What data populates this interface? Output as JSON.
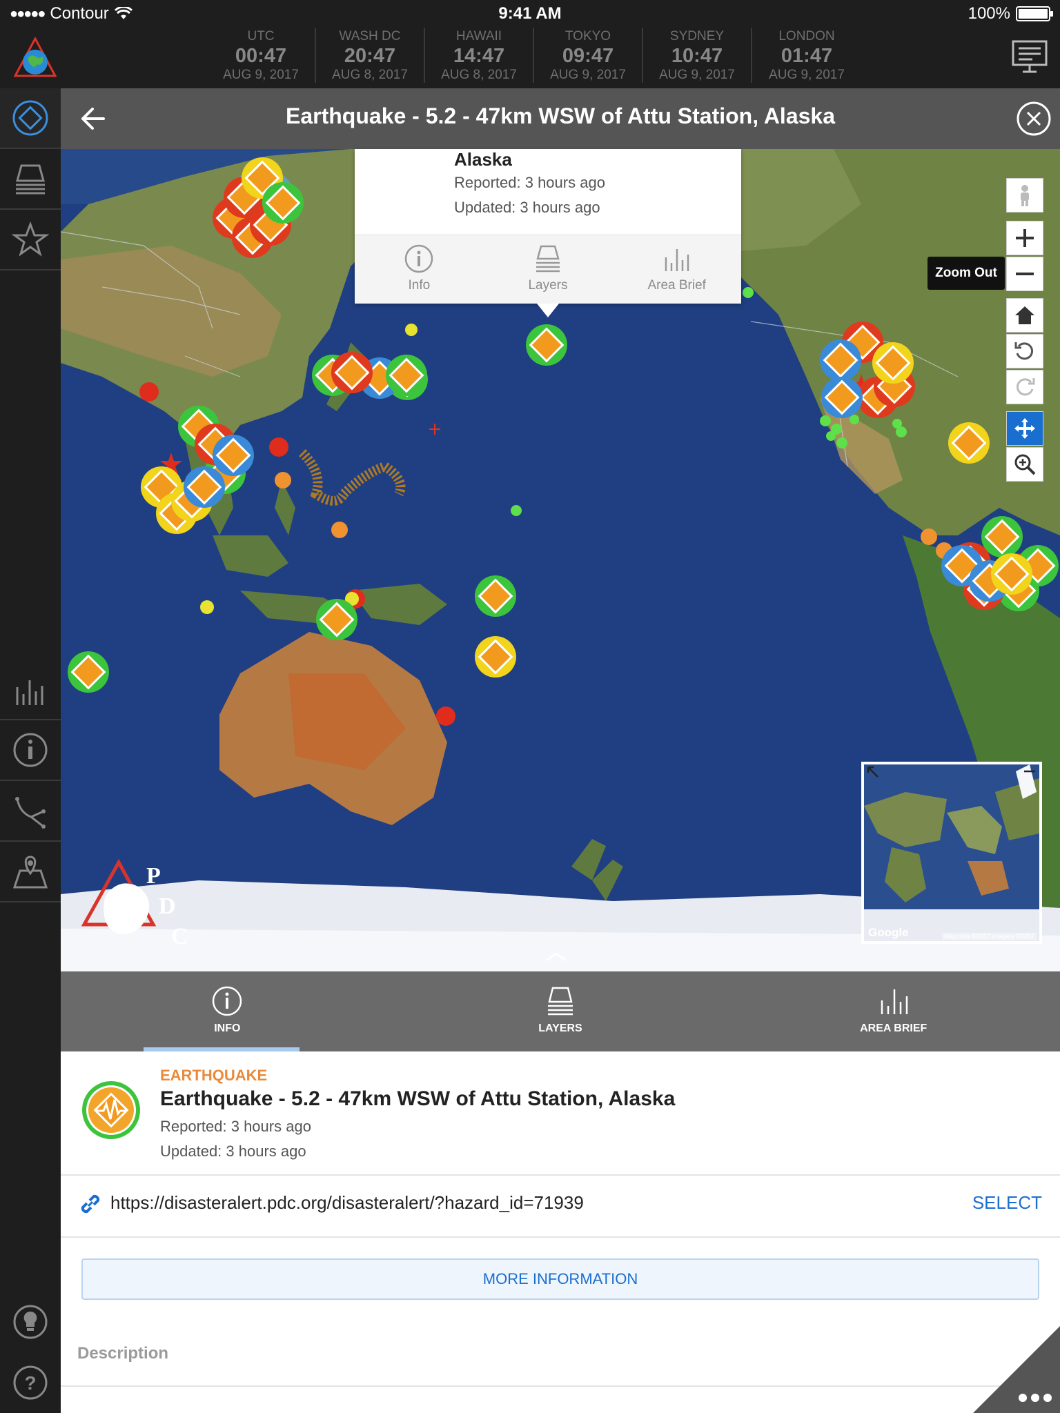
{
  "status_bar": {
    "carrier": "Contour",
    "time": "9:41 AM",
    "battery": "100%",
    "battery_level": 1.0
  },
  "clocks": [
    {
      "city": "UTC",
      "time": "00:47",
      "date": "AUG 9, 2017"
    },
    {
      "city": "WASH DC",
      "time": "20:47",
      "date": "AUG 8, 2017"
    },
    {
      "city": "HAWAII",
      "time": "14:47",
      "date": "AUG 8, 2017"
    },
    {
      "city": "TOKYO",
      "time": "09:47",
      "date": "AUG 9, 2017"
    },
    {
      "city": "SYDNEY",
      "time": "10:47",
      "date": "AUG 9, 2017"
    },
    {
      "city": "LONDON",
      "time": "01:47",
      "date": "AUG 9, 2017"
    }
  ],
  "title_bar": {
    "title": "Earthquake - 5.2 - 47km WSW of Attu Station, Alaska"
  },
  "popup": {
    "title": "Alaska",
    "reported": "Reported: 3 hours ago",
    "updated": "Updated: 3 hours ago",
    "tabs": [
      "Info",
      "Layers",
      "Area Brief"
    ]
  },
  "map": {
    "tooltip": "Zoom Out",
    "logo_letters": [
      "P",
      "D",
      "C"
    ],
    "minimap_google": "Google",
    "minimap_credits": "Map data ©2017 Imagery ©2017"
  },
  "bottom_tabs": [
    {
      "label": "INFO",
      "active": true
    },
    {
      "label": "LAYERS",
      "active": false
    },
    {
      "label": "AREA BRIEF",
      "active": false
    }
  ],
  "detail": {
    "type": "EARTHQUAKE",
    "title": "Earthquake - 5.2 - 47km WSW of Attu Station, Alaska",
    "reported": "Reported: 3 hours ago",
    "updated": "Updated: 3 hours ago",
    "url": "https://disasteralert.pdc.org/disasteralert/?hazard_id=71939",
    "select_label": "SELECT",
    "more_label": "MORE INFORMATION",
    "description_label": "Description"
  },
  "colors": {
    "accent_blue": "#1a6ed0",
    "earthquake_orange": "#e88a3a",
    "hazard_green": "#3cc43c",
    "hazard_red": "#e03a1e",
    "hazard_yellow": "#f2d41c"
  }
}
